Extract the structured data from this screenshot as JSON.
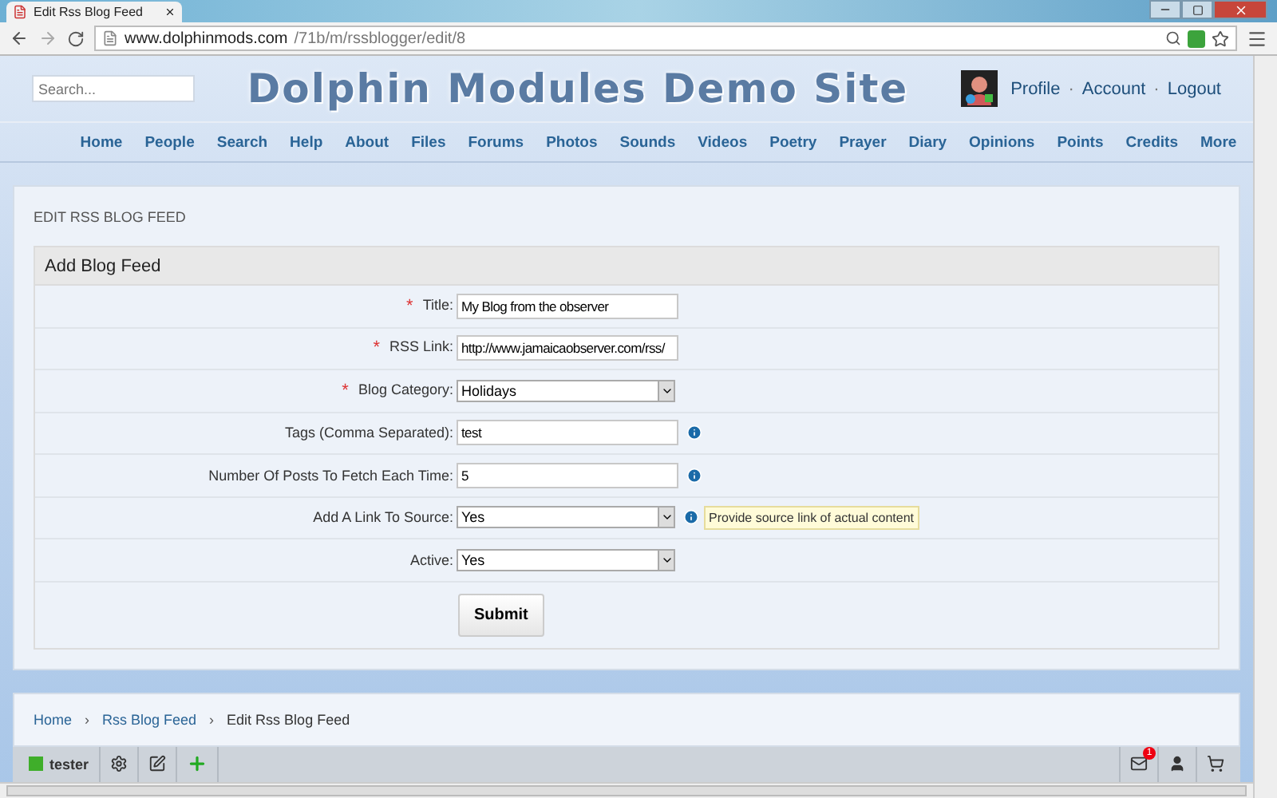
{
  "browser": {
    "tab_title": "Edit Rss Blog Feed",
    "url_host": "www.dolphinmods.com",
    "url_path": "/71b/m/rssblogger/edit/8"
  },
  "header": {
    "search_placeholder": "Search...",
    "site_title": "Dolphin Modules Demo Site",
    "user_links": [
      "Profile",
      "Account",
      "Logout"
    ],
    "separator": "·"
  },
  "nav": [
    "Home",
    "People",
    "Search",
    "Help",
    "About",
    "Files",
    "Forums",
    "Photos",
    "Sounds",
    "Videos",
    "Poetry",
    "Prayer",
    "Diary",
    "Opinions",
    "Points",
    "Credits",
    "More"
  ],
  "page_title": "EDIT RSS BLOG FEED",
  "form": {
    "title": "Add Blog Feed",
    "required_mark": "*",
    "fields": [
      {
        "label": "Title:",
        "kind": "text",
        "value": "My Blog from the observer",
        "required": true,
        "info": false
      },
      {
        "label": "RSS Link:",
        "kind": "text",
        "value": "http://www.jamaicaobserver.com/rss/",
        "required": true,
        "info": false
      },
      {
        "label": "Blog Category:",
        "kind": "select",
        "value": "Holidays",
        "required": true,
        "info": false
      },
      {
        "label": "Tags (Comma Separated):",
        "kind": "text",
        "value": "test",
        "required": false,
        "info": true
      },
      {
        "label": "Number Of Posts To Fetch Each Time:",
        "kind": "text",
        "value": "5",
        "required": false,
        "info": true
      },
      {
        "label": "Add A Link To Source:",
        "kind": "select",
        "value": "Yes",
        "required": false,
        "info": true,
        "tooltip": "Provide source link of actual content"
      },
      {
        "label": "Active:",
        "kind": "select",
        "value": "Yes",
        "required": false,
        "info": false
      }
    ],
    "submit": "Submit"
  },
  "breadcrumb": [
    {
      "label": "Home",
      "link": true
    },
    {
      "label": "Rss Blog Feed",
      "link": true
    },
    {
      "label": "Edit Rss Blog Feed",
      "link": false
    }
  ],
  "breadcrumb_separator": "›",
  "toolbar": {
    "user": "tester",
    "online": true,
    "mail_badge": "1"
  }
}
